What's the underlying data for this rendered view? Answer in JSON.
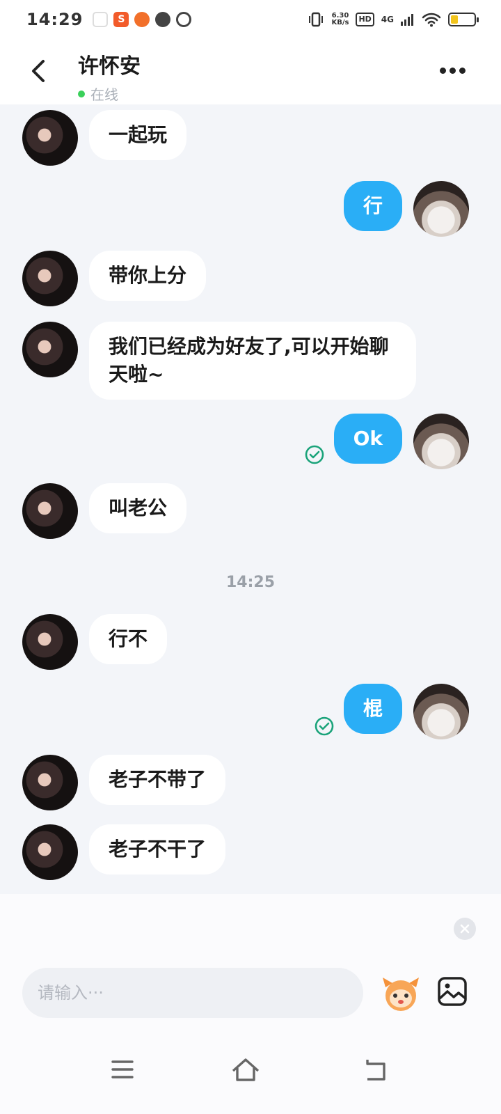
{
  "status_bar": {
    "time": "14:29",
    "net_speed_value": "6.30",
    "net_speed_unit": "KB/s",
    "hd": "HD",
    "signal": "4G",
    "battery_level": 0.3
  },
  "header": {
    "contact_name": "许怀安",
    "status": "在线"
  },
  "messages": [
    {
      "from": "other",
      "text": "一起玩"
    },
    {
      "from": "self",
      "text": "行"
    },
    {
      "from": "other",
      "text": "带你上分"
    },
    {
      "from": "other",
      "text": "我们已经成为好友了,可以开始聊天啦~"
    },
    {
      "from": "self",
      "text": "Ok",
      "read": true
    },
    {
      "from": "other",
      "text": "叫老公"
    },
    {
      "divider": "14:25"
    },
    {
      "from": "other",
      "text": "行不"
    },
    {
      "from": "self",
      "text": "棍",
      "read": true
    },
    {
      "from": "other",
      "text": "老子不带了"
    },
    {
      "from": "other",
      "text": "老子不干了"
    }
  ],
  "input": {
    "placeholder": "请输入···"
  },
  "colors": {
    "self_bubble": "#2aaef6",
    "online": "#3ad05a",
    "read_check": "#1aa37a"
  },
  "icons": [
    "back-icon",
    "more-icon",
    "close-icon",
    "emoji-icon",
    "image-icon",
    "menu-icon",
    "home-icon",
    "back-nav-icon"
  ]
}
